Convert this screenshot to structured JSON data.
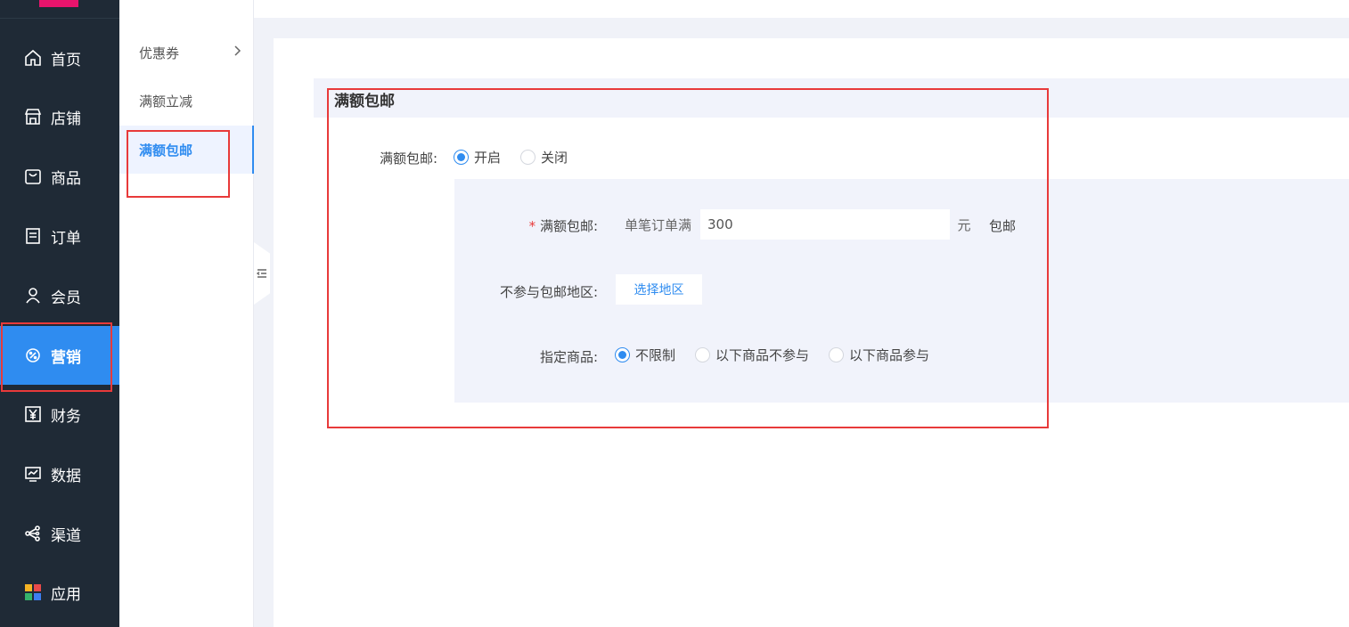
{
  "nav": {
    "items": [
      {
        "label": "首页",
        "icon": "home-icon"
      },
      {
        "label": "店铺",
        "icon": "store-icon"
      },
      {
        "label": "商品",
        "icon": "bag-icon"
      },
      {
        "label": "订单",
        "icon": "order-icon"
      },
      {
        "label": "会员",
        "icon": "user-icon"
      },
      {
        "label": "营销",
        "icon": "marketing-icon"
      },
      {
        "label": "财务",
        "icon": "yen-icon"
      },
      {
        "label": "数据",
        "icon": "chart-icon"
      },
      {
        "label": "渠道",
        "icon": "share-icon"
      },
      {
        "label": "应用",
        "icon": "apps-icon"
      }
    ],
    "active": "营销"
  },
  "submenu": {
    "items": [
      {
        "label": "优惠券"
      },
      {
        "label": "满额立减"
      },
      {
        "label": "满额包邮"
      }
    ],
    "active": "满额包邮"
  },
  "section": {
    "title": "满额包邮",
    "toggle_label": "满额包邮:",
    "toggle_options": [
      "开启",
      "关闭"
    ],
    "toggle_selected": "开启",
    "threshold": {
      "required_mark": "*",
      "label": "满额包邮:",
      "prefix": "单笔订单满",
      "value": "300",
      "suffix": "元",
      "after": "包邮"
    },
    "exclude_region": {
      "label": "不参与包邮地区:",
      "button": "选择地区"
    },
    "goods": {
      "label": "指定商品:",
      "options": [
        "不限制",
        "以下商品不参与",
        "以下商品参与"
      ],
      "selected": "不限制"
    }
  },
  "colors": {
    "accent": "#2f8cf0",
    "nav_bg": "#1f2a36",
    "highlight_box": "#e83a3a"
  }
}
